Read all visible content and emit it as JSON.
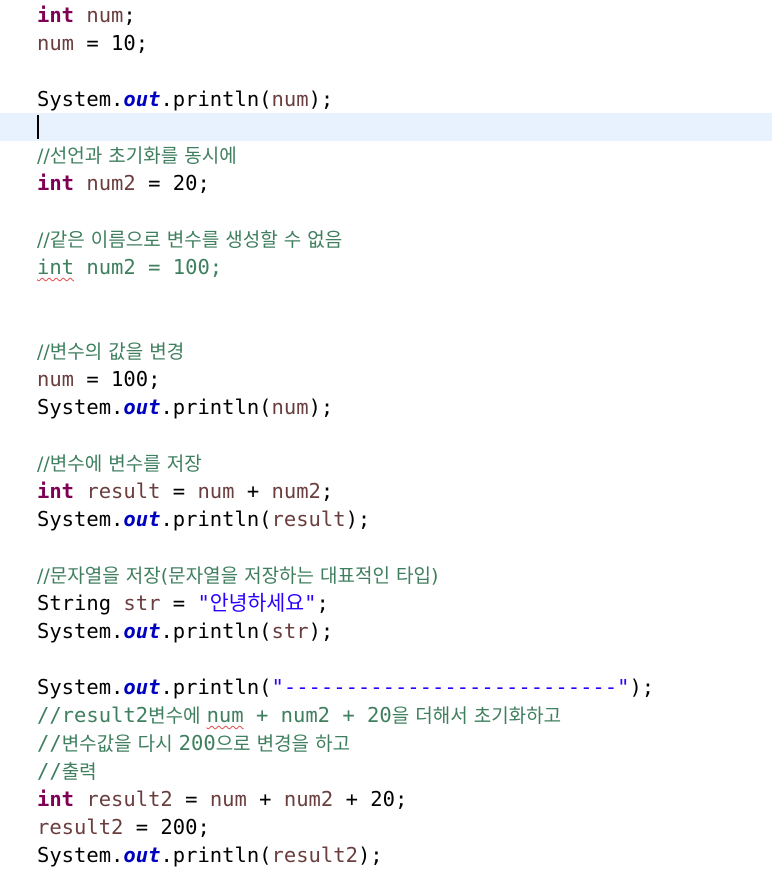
{
  "editor": {
    "lines": [
      {
        "id": 1,
        "tokens": [
          {
            "t": "int",
            "c": "kw"
          },
          {
            "t": " ",
            "c": "plain"
          },
          {
            "t": "num",
            "c": "var"
          },
          {
            "t": ";",
            "c": "plain"
          }
        ]
      },
      {
        "id": 2,
        "tokens": [
          {
            "t": "num",
            "c": "var"
          },
          {
            "t": " = 10;",
            "c": "plain"
          }
        ]
      },
      {
        "id": 3,
        "tokens": []
      },
      {
        "id": 4,
        "tokens": [
          {
            "t": "System.",
            "c": "plain"
          },
          {
            "t": "out",
            "c": "field"
          },
          {
            "t": ".println(",
            "c": "plain"
          },
          {
            "t": "num",
            "c": "var"
          },
          {
            "t": ");",
            "c": "plain"
          }
        ]
      },
      {
        "id": 5,
        "tokens": [],
        "current": true
      },
      {
        "id": 6,
        "tokens": [
          {
            "t": "//선언과 초기화를 동시에",
            "c": "comment"
          }
        ]
      },
      {
        "id": 7,
        "tokens": [
          {
            "t": "int",
            "c": "kw"
          },
          {
            "t": " ",
            "c": "plain"
          },
          {
            "t": "num2",
            "c": "var"
          },
          {
            "t": " = 20;",
            "c": "plain"
          }
        ]
      },
      {
        "id": 8,
        "tokens": []
      },
      {
        "id": 9,
        "tokens": [
          {
            "t": "//같은 이름으로 변수를 생성할 수 없음",
            "c": "comment"
          }
        ]
      },
      {
        "id": 10,
        "tokens": [
          {
            "t": "int",
            "c": "dim err"
          },
          {
            "t": " num2 = 100;",
            "c": "dim"
          }
        ]
      },
      {
        "id": 11,
        "tokens": []
      },
      {
        "id": 12,
        "tokens": []
      },
      {
        "id": 13,
        "tokens": [
          {
            "t": "//변수의 값을 변경",
            "c": "comment"
          }
        ]
      },
      {
        "id": 14,
        "tokens": [
          {
            "t": "num",
            "c": "var"
          },
          {
            "t": " = 100;",
            "c": "plain"
          }
        ]
      },
      {
        "id": 15,
        "tokens": [
          {
            "t": "System.",
            "c": "plain"
          },
          {
            "t": "out",
            "c": "field"
          },
          {
            "t": ".println(",
            "c": "plain"
          },
          {
            "t": "num",
            "c": "var"
          },
          {
            "t": ");",
            "c": "plain"
          }
        ]
      },
      {
        "id": 16,
        "tokens": []
      },
      {
        "id": 17,
        "tokens": [
          {
            "t": "//변수에 변수를 저장",
            "c": "comment"
          }
        ]
      },
      {
        "id": 18,
        "tokens": [
          {
            "t": "int",
            "c": "kw"
          },
          {
            "t": " ",
            "c": "plain"
          },
          {
            "t": "result",
            "c": "var"
          },
          {
            "t": " = ",
            "c": "plain"
          },
          {
            "t": "num",
            "c": "var"
          },
          {
            "t": " + ",
            "c": "plain"
          },
          {
            "t": "num2",
            "c": "var"
          },
          {
            "t": ";",
            "c": "plain"
          }
        ]
      },
      {
        "id": 19,
        "tokens": [
          {
            "t": "System.",
            "c": "plain"
          },
          {
            "t": "out",
            "c": "field"
          },
          {
            "t": ".println(",
            "c": "plain"
          },
          {
            "t": "result",
            "c": "var"
          },
          {
            "t": ");",
            "c": "plain"
          }
        ]
      },
      {
        "id": 20,
        "tokens": []
      },
      {
        "id": 21,
        "tokens": [
          {
            "t": "//문자열을 저장(문자열을 저장하는 대표적인 타입)",
            "c": "comment"
          }
        ]
      },
      {
        "id": 22,
        "tokens": [
          {
            "t": "String ",
            "c": "plain"
          },
          {
            "t": "str",
            "c": "var"
          },
          {
            "t": " = ",
            "c": "plain"
          },
          {
            "t": "\"안녕하세요\"",
            "c": "str"
          },
          {
            "t": ";",
            "c": "plain"
          }
        ]
      },
      {
        "id": 23,
        "tokens": [
          {
            "t": "System.",
            "c": "plain"
          },
          {
            "t": "out",
            "c": "field"
          },
          {
            "t": ".println(",
            "c": "plain"
          },
          {
            "t": "str",
            "c": "var"
          },
          {
            "t": ");",
            "c": "plain"
          }
        ]
      },
      {
        "id": 24,
        "tokens": []
      },
      {
        "id": 25,
        "tokens": [
          {
            "t": "System.",
            "c": "plain"
          },
          {
            "t": "out",
            "c": "field"
          },
          {
            "t": ".println(",
            "c": "plain"
          },
          {
            "t": "\"---------------------------\"",
            "c": "str"
          },
          {
            "t": ");",
            "c": "plain"
          }
        ]
      },
      {
        "id": 26,
        "tokens": [
          {
            "t": "//result2",
            "c": "comment-mono"
          },
          {
            "t": "변수에 ",
            "c": "comment"
          },
          {
            "t": "num",
            "c": "comment-mono err"
          },
          {
            "t": " + num2 + 20",
            "c": "comment-mono"
          },
          {
            "t": "을 더해서 초기화하고",
            "c": "comment"
          }
        ]
      },
      {
        "id": 27,
        "tokens": [
          {
            "t": "//",
            "c": "comment-mono"
          },
          {
            "t": "변수값을 다시 ",
            "c": "comment"
          },
          {
            "t": "200",
            "c": "comment-mono"
          },
          {
            "t": "으로 변경을 하고",
            "c": "comment"
          }
        ]
      },
      {
        "id": 28,
        "tokens": [
          {
            "t": "//",
            "c": "comment-mono"
          },
          {
            "t": "출력",
            "c": "comment"
          }
        ]
      },
      {
        "id": 29,
        "tokens": [
          {
            "t": "int",
            "c": "kw"
          },
          {
            "t": " ",
            "c": "plain"
          },
          {
            "t": "result2",
            "c": "var"
          },
          {
            "t": " = ",
            "c": "plain"
          },
          {
            "t": "num",
            "c": "var"
          },
          {
            "t": " + ",
            "c": "plain"
          },
          {
            "t": "num2",
            "c": "var"
          },
          {
            "t": " + 20;",
            "c": "plain"
          }
        ]
      },
      {
        "id": 30,
        "tokens": [
          {
            "t": "result2",
            "c": "var"
          },
          {
            "t": " = 200;",
            "c": "plain"
          }
        ]
      },
      {
        "id": 31,
        "tokens": [
          {
            "t": "System.",
            "c": "plain"
          },
          {
            "t": "out",
            "c": "field"
          },
          {
            "t": ".println(",
            "c": "plain"
          },
          {
            "t": "result2",
            "c": "var"
          },
          {
            "t": ");",
            "c": "plain"
          }
        ]
      }
    ]
  }
}
